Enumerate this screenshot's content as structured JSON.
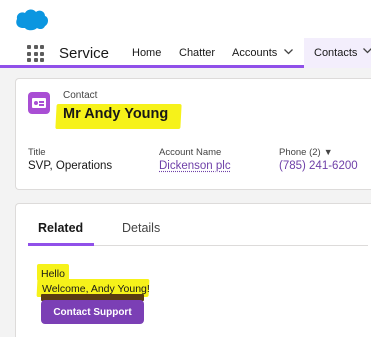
{
  "app": {
    "name": "Service",
    "logo_icon": "cloud-icon",
    "logo_color": "#0b96e0"
  },
  "nav": {
    "items": [
      "Home",
      "Chatter",
      "Accounts",
      "Contacts"
    ],
    "active": "Contacts",
    "accent_color": "#9050e9"
  },
  "record": {
    "object_label": "Contact",
    "name": "Mr Andy Young",
    "icon": "contact-card-icon",
    "fields": [
      {
        "label": "Title",
        "value": "SVP, Operations"
      },
      {
        "label": "Account Name",
        "value": "Dickenson plc"
      },
      {
        "label": "Phone (2)",
        "value": "(785) 241-6200"
      }
    ]
  },
  "tabs": [
    "Related",
    "Details"
  ],
  "active_tab": "Related",
  "component": {
    "greeting": "Hello",
    "welcome": "Welcome, Andy Young!",
    "button_label": "Contact Support",
    "button_color": "#7b3fb5"
  },
  "highlight_color": "#f6f21a"
}
